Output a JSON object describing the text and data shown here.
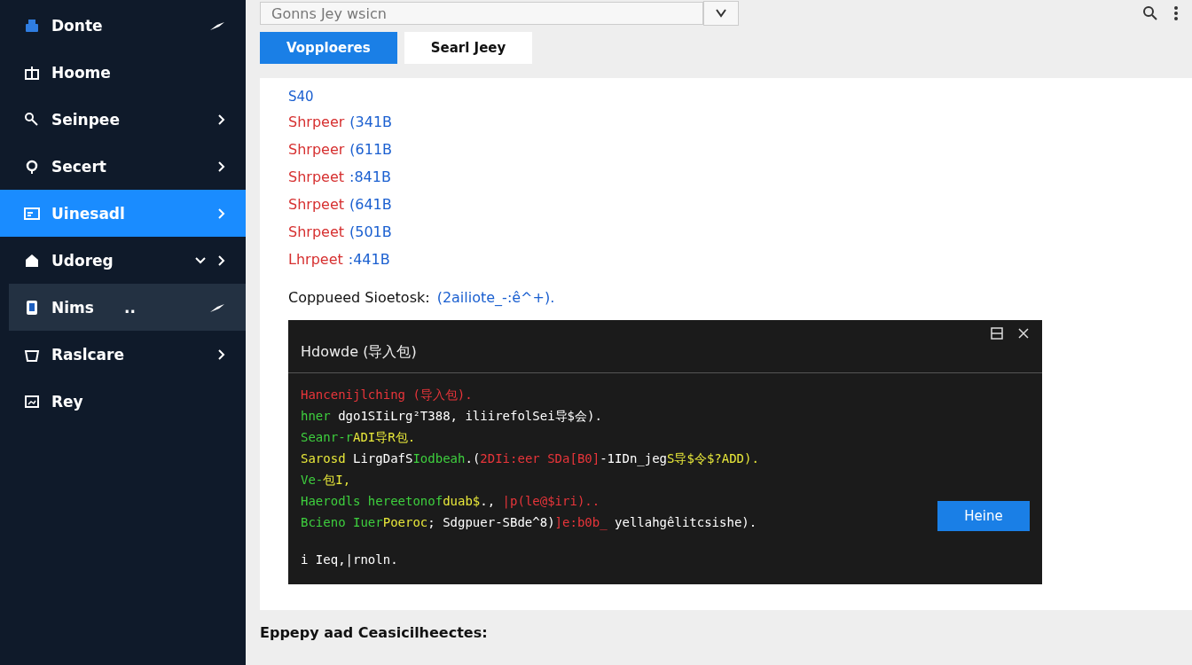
{
  "sidebar": {
    "items": [
      {
        "label": "Donte",
        "selected": false,
        "highlighted": false,
        "chevron": false,
        "expandable": false,
        "pinned": true
      },
      {
        "label": "Hoome",
        "selected": false,
        "highlighted": false,
        "chevron": false,
        "expandable": false,
        "pinned": false
      },
      {
        "label": "Seinpee",
        "selected": false,
        "highlighted": false,
        "chevron": true,
        "expandable": false,
        "pinned": false
      },
      {
        "label": "Secert",
        "selected": false,
        "highlighted": false,
        "chevron": true,
        "expandable": false,
        "pinned": false
      },
      {
        "label": "Uinesadl",
        "selected": true,
        "highlighted": false,
        "chevron": true,
        "expandable": false,
        "pinned": false
      },
      {
        "label": "Udoreg",
        "selected": false,
        "highlighted": false,
        "chevron": true,
        "expandable": true,
        "pinned": false
      },
      {
        "label": "Nims",
        "badge": "..",
        "selected": false,
        "highlighted": true,
        "chevron": false,
        "expandable": false,
        "pinned": true
      },
      {
        "label": "Raslcare",
        "selected": false,
        "highlighted": false,
        "chevron": true,
        "expandable": false,
        "pinned": false
      },
      {
        "label": "Rey",
        "selected": false,
        "highlighted": false,
        "chevron": false,
        "expandable": false,
        "pinned": false
      }
    ]
  },
  "search": {
    "value": "Gonns Jey wsicn"
  },
  "tabs": [
    {
      "label": "Vopploeres",
      "selected": true
    },
    {
      "label": "Searl Jeey",
      "selected": false
    }
  ],
  "content": {
    "heading": "S40",
    "entries": [
      {
        "name": "Shrpeer",
        "value": "(341B"
      },
      {
        "name": "Shrpeer",
        "value": "(611B"
      },
      {
        "name": "Shrpeet",
        "value": ":841B"
      },
      {
        "name": "Shrpeet",
        "value": "(641B"
      },
      {
        "name": "Shrpeet",
        "value": "(501B"
      },
      {
        "name": "Lhrpeet",
        "value": ":441B"
      }
    ],
    "summary_label": "Coppueed Sioetosk:",
    "summary_value": "(2ailiote_-:ê^+)."
  },
  "terminal": {
    "title": "Hdowde (导入包)",
    "lines": [
      {
        "segments": [
          {
            "text": "Hancenijlching (导入包).",
            "color": "#e8353a"
          }
        ]
      },
      {
        "segments": [
          {
            "text": "hner",
            "color": "#3ecf3e"
          },
          {
            "text": " dgo1SIiLrg²T388, iliirefolSei导$会).",
            "color": "#ffffff"
          }
        ]
      },
      {
        "segments": [
          {
            "text": "Seanr-r",
            "color": "#3ecf3e"
          },
          {
            "text": "ADI导R包.",
            "color": "#e8e83a"
          }
        ]
      },
      {
        "segments": [
          {
            "text": "Sarosd",
            "color": "#e8e83a"
          },
          {
            "text": " LirgDafS",
            "color": "#ffffff"
          },
          {
            "text": "Iodbeah",
            "color": "#3ecf3e"
          },
          {
            "text": ".(",
            "color": "#ffffff"
          },
          {
            "text": "2DIi:eer SDa[B0]",
            "color": "#e8353a"
          },
          {
            "text": "-1IDn_jeg",
            "color": "#ffffff"
          },
          {
            "text": "S导$令$?ADD).",
            "color": "#e8e83a"
          }
        ]
      },
      {
        "segments": [
          {
            "text": "Ve-",
            "color": "#3ecf3e"
          },
          {
            "text": "包I,",
            "color": "#e8e83a"
          }
        ]
      },
      {
        "segments": [
          {
            "text": "Haerodls hereetonof",
            "color": "#3ecf3e"
          },
          {
            "text": "duab$",
            "color": "#e8e83a"
          },
          {
            "text": "., ",
            "color": "#ffffff"
          },
          {
            "text": "|p(le@$iri)..",
            "color": "#e8353a"
          }
        ]
      },
      {
        "segments": [
          {
            "text": "Bcieno Iuer",
            "color": "#3ecf3e"
          },
          {
            "text": "Poeroc",
            "color": "#e8e83a"
          },
          {
            "text": "; Sdgpuer-SBde^8)",
            "color": "#ffffff"
          },
          {
            "text": "]e:b0b_",
            "color": "#e8353a"
          },
          {
            "text": " yellahgêlitcsishe).",
            "color": "#ffffff"
          }
        ]
      }
    ],
    "prompt": "i Ieq,|rnoln.",
    "button": "Heine"
  },
  "footer": "Eppepy aad Ceasicilheectes:"
}
